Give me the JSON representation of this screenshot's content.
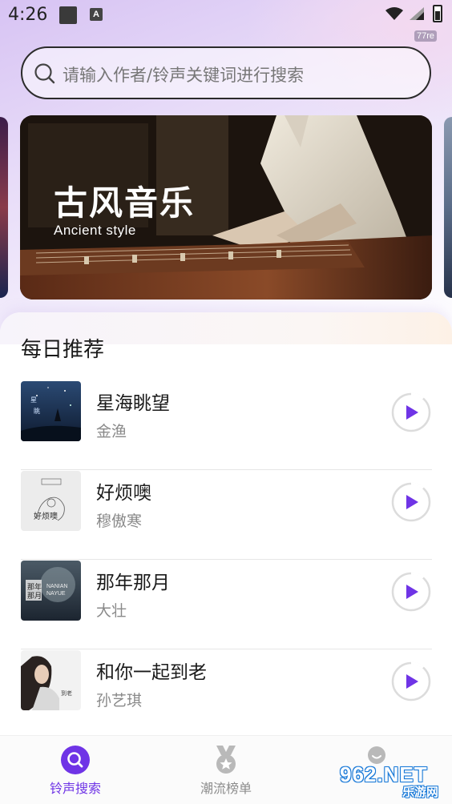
{
  "status_bar": {
    "time": "4:26",
    "notif_letter": "A",
    "corner_badge": "77re"
  },
  "search": {
    "placeholder": "请输入作者/铃声关键词进行搜索"
  },
  "banner": {
    "title": "古风音乐",
    "subtitle": "Ancient style"
  },
  "recommend": {
    "title": "每日推荐",
    "songs": [
      {
        "title": "星海眺望",
        "artist": "金渔"
      },
      {
        "title": "好烦噢",
        "artist": "穆傲寒"
      },
      {
        "title": "那年那月",
        "artist": "大壮"
      },
      {
        "title": "和你一起到老",
        "artist": "孙艺琪"
      }
    ]
  },
  "tabs": [
    {
      "label": "铃声搜索",
      "icon": "search-icon",
      "active": true
    },
    {
      "label": "潮流榜单",
      "icon": "medal-icon",
      "active": false
    },
    {
      "label": "",
      "icon": "profile-icon",
      "active": false
    }
  ],
  "watermark": {
    "text": "962.NET",
    "sub": "乐游网"
  },
  "colors": {
    "accent": "#6f34e6",
    "text_primary": "#1a1a1a",
    "text_secondary": "#8a8a8a"
  }
}
